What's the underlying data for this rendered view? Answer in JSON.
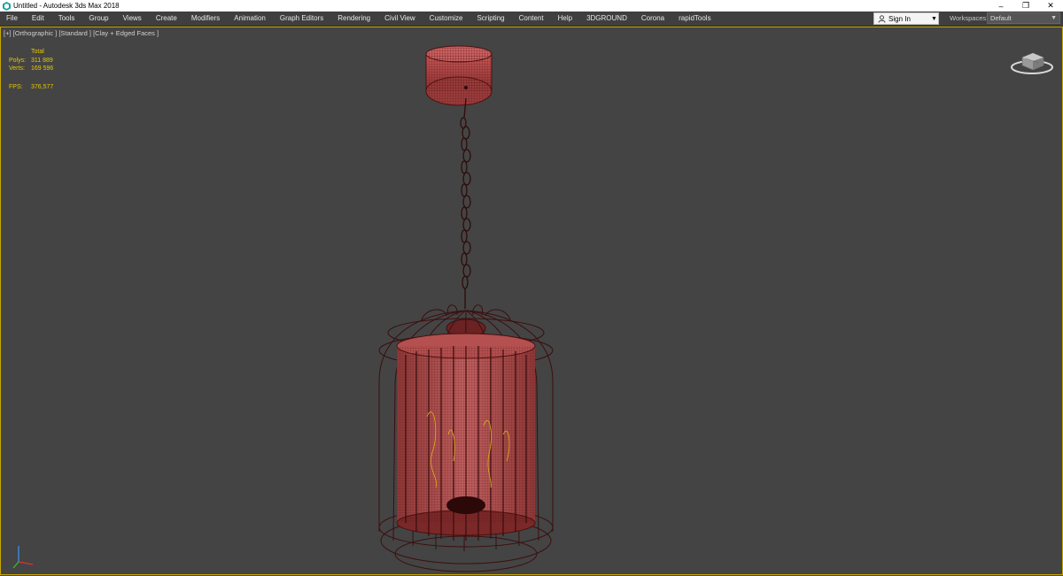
{
  "window": {
    "title": "Untitled - Autodesk 3ds Max 2018",
    "controls": {
      "minimize": "–",
      "restore": "❐",
      "close": "✕"
    }
  },
  "menubar": {
    "items": [
      "File",
      "Edit",
      "Tools",
      "Group",
      "Views",
      "Create",
      "Modifiers",
      "Animation",
      "Graph Editors",
      "Rendering",
      "Civil View",
      "Customize",
      "Scripting",
      "Content",
      "Help",
      "3DGROUND",
      "Corona",
      "rapidTools"
    ],
    "sign_in": {
      "label": "Sign In",
      "icon": "user-icon"
    },
    "workspaces": {
      "label": "Workspaces:",
      "value": "Default"
    }
  },
  "viewport": {
    "label": "[+] [Orthographic ] [Standard ] [Clay + Edged Faces ]",
    "stats": {
      "header": "Total",
      "polys_label": "Polys:",
      "polys_value": "311 889",
      "verts_label": "Verts:",
      "verts_value": "169 596",
      "fps_label": "FPS:",
      "fps_value": "376,577"
    },
    "colors": {
      "background": "#444444",
      "border_active": "#c8a800",
      "stats_text": "#e6c800",
      "wire": "#4a1010",
      "clay_surface": "#b04848",
      "bulb_filament": "#e0b020"
    }
  }
}
